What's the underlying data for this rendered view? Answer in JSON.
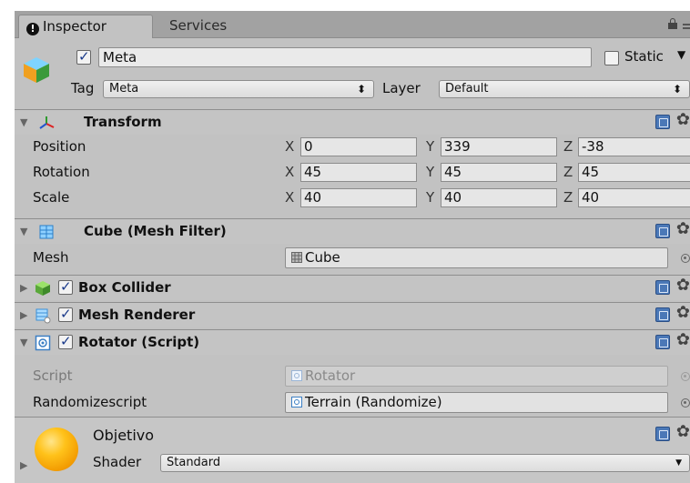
{
  "tabs": {
    "inspector": "Inspector",
    "services": "Services"
  },
  "gameobject": {
    "active": true,
    "name": "Meta",
    "static_label": "Static",
    "tag_label": "Tag",
    "tag_value": "Meta",
    "layer_label": "Layer",
    "layer_value": "Default"
  },
  "transform": {
    "title": "Transform",
    "position_label": "Position",
    "rotation_label": "Rotation",
    "scale_label": "Scale",
    "axis_x": "X",
    "axis_y": "Y",
    "axis_z": "Z",
    "position": {
      "x": "0",
      "y": "339",
      "z": "-38"
    },
    "rotation": {
      "x": "45",
      "y": "45",
      "z": "45"
    },
    "scale": {
      "x": "40",
      "y": "40",
      "z": "40"
    }
  },
  "mesh_filter": {
    "title": "Cube (Mesh Filter)",
    "mesh_label": "Mesh",
    "mesh_value": "Cube"
  },
  "box_collider": {
    "title": "Box Collider",
    "enabled": true
  },
  "mesh_renderer": {
    "title": "Mesh Renderer",
    "enabled": true
  },
  "rotator": {
    "title": "Rotator (Script)",
    "enabled": true,
    "script_label": "Script",
    "script_value": "Rotator",
    "randomize_label": "Randomizescript",
    "randomize_value": "Terrain (Randomize)"
  },
  "material": {
    "name": "Objetivo",
    "shader_label": "Shader",
    "shader_value": "Standard"
  },
  "icons": {
    "dropdown_arrow": "⬍",
    "gear": "✿"
  }
}
